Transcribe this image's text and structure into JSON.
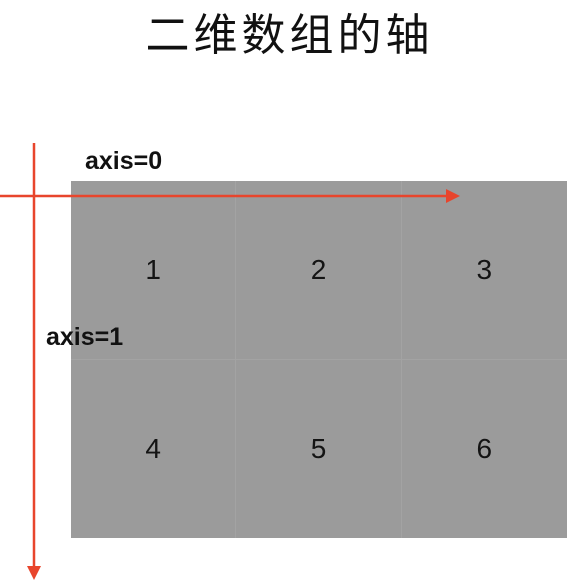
{
  "title": "二维数组的轴",
  "axes": {
    "axis0_label": "axis=0",
    "axis1_label": "axis=1"
  },
  "grid": {
    "rows": [
      [
        "1",
        "2",
        "3"
      ],
      [
        "4",
        "5",
        "6"
      ]
    ]
  },
  "colors": {
    "arrow": "#e8452c",
    "cell_background": "#9b9b9b",
    "text": "#141414"
  }
}
